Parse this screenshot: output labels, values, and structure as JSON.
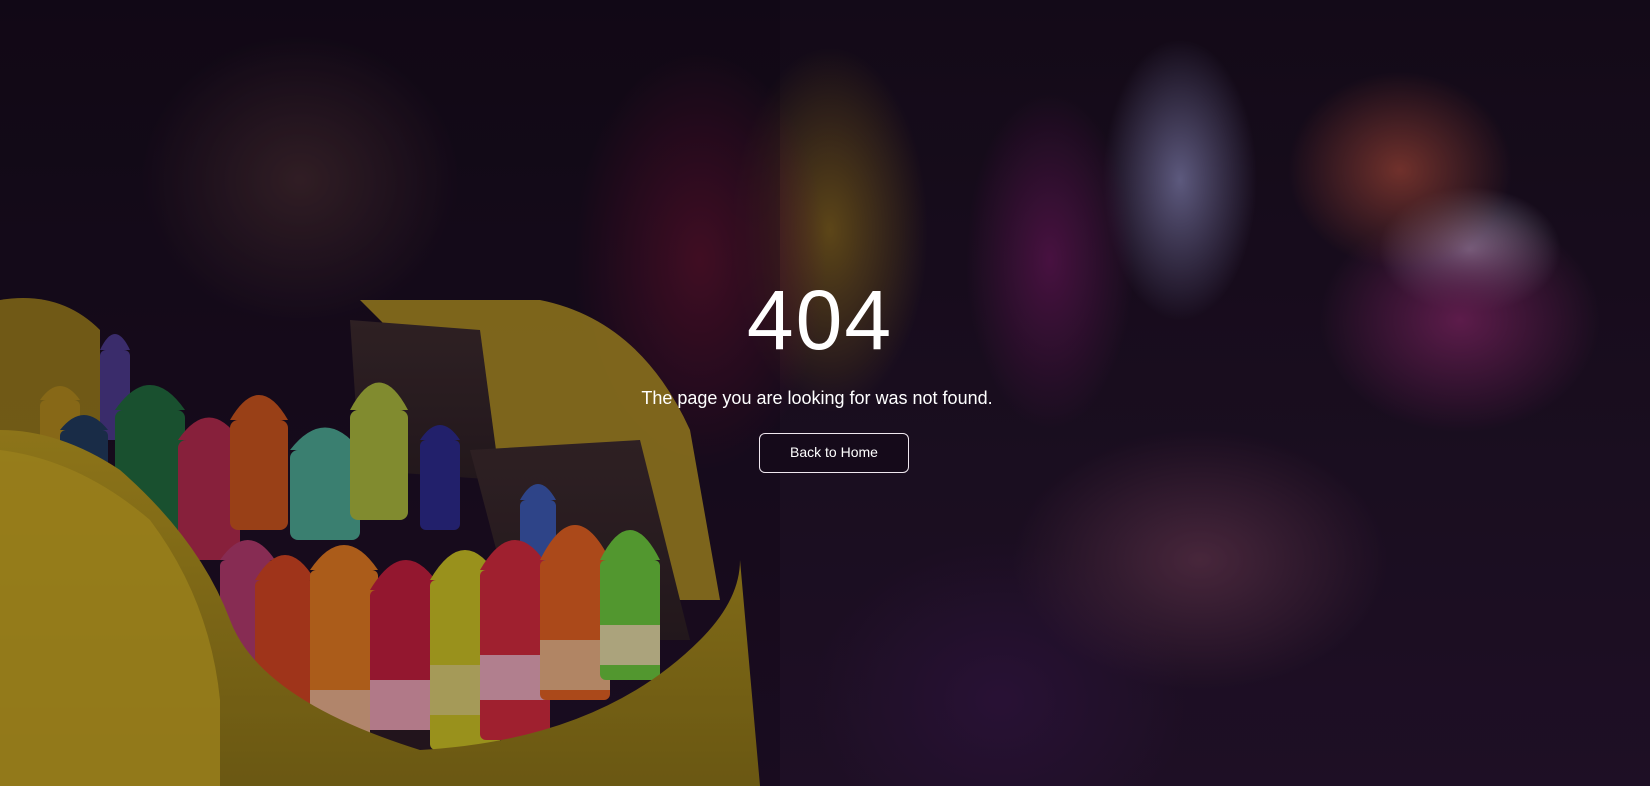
{
  "error": {
    "code": "404",
    "message": "The page you are looking for was not found.",
    "back_button_label": "Back to Home"
  },
  "colors": {
    "text": "#ffffff",
    "button_border": "#f0e8f0",
    "overlay": "#120a14"
  }
}
